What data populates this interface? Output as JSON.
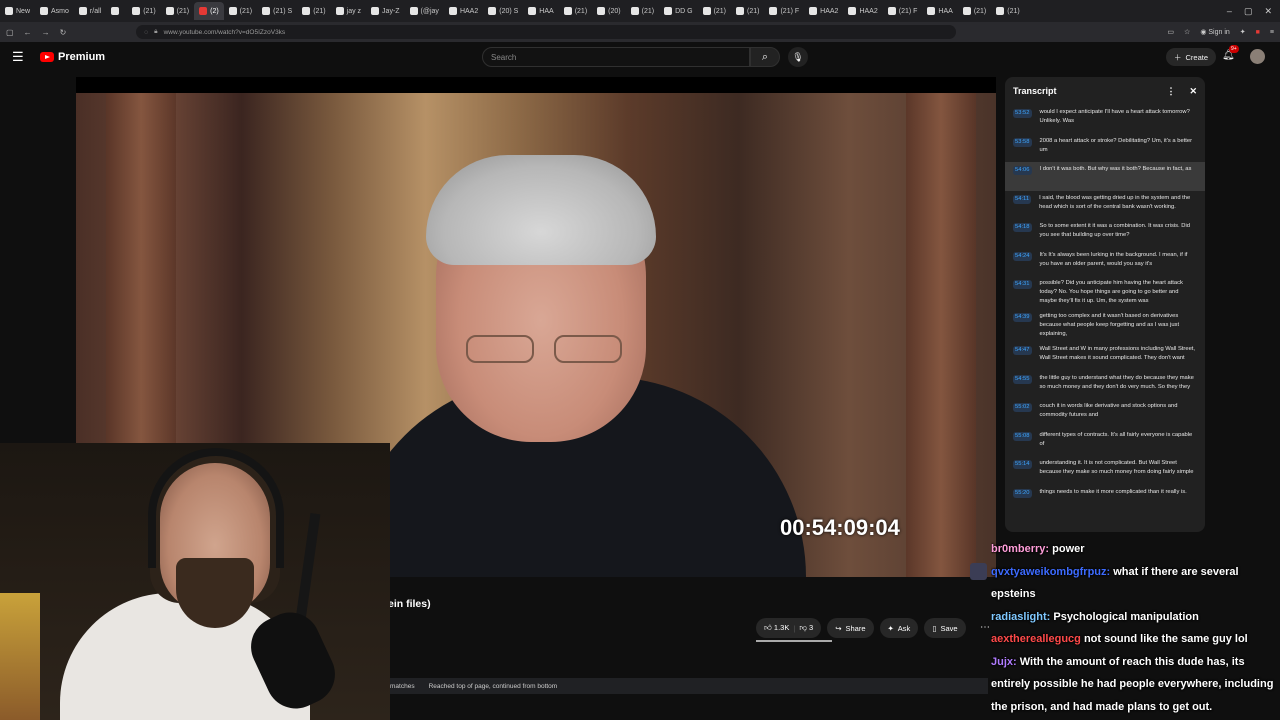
{
  "browser": {
    "tabs": [
      "New",
      "Asmo",
      "r/all",
      "",
      "(21)",
      "(21)",
      "(2)",
      "(21)",
      "(21) S",
      "(21)",
      "jay z",
      "Jay-Z",
      "(@jay",
      "HAA2",
      "(20) S",
      "HAA",
      "(21)",
      "(20)",
      "(21)",
      "DD G",
      "(21)",
      "(21)",
      "(21) F",
      "HAA2",
      "HAA2",
      "(21) F",
      "HAA",
      "(21)",
      "(21)"
    ],
    "url": "www.youtube.com/watch?v=dO5IZzoV3ks",
    "sign_in": "Sign in"
  },
  "youtube": {
    "brand": "Premium",
    "search_placeholder": "Search",
    "create_label": "Create",
    "notif_badge": "9+"
  },
  "video": {
    "timecode": "00:54:09:04",
    "title_fragment": "ein files)",
    "likes": "1.3K",
    "dislikes": "3",
    "share": "Share",
    "ask": "Ask",
    "save": "Save"
  },
  "findbar": {
    "matches": "matches",
    "status": "Reached top of page, continued from bottom"
  },
  "transcript": {
    "title": "Transcript",
    "rows": [
      {
        "time": "53:52",
        "text": "would I expect anticipate I'll have a heart attack tomorrow? Unlikely. Was"
      },
      {
        "time": "53:58",
        "text": "2008 a heart attack or stroke? Debilitating? Um, it's a better um"
      },
      {
        "time": "54:06",
        "text": "I don't it was both. But why was it both? Because in fact, as"
      },
      {
        "time": "54:11",
        "text": "I said, the blood was getting dried up in the system and the head which is sort of the central bank wasn't working."
      },
      {
        "time": "54:18",
        "text": "So to some extent it it was a combination. It was crisis. Did you see that building up over time?"
      },
      {
        "time": "54:24",
        "text": "It's It's always been lurking in the background. I mean, if if you have an older parent, would you say it's"
      },
      {
        "time": "54:31",
        "text": "possible? Did you anticipate him having the heart attack today? No. You hope things are going to go better and maybe they'll fix it up. Um, the system was"
      },
      {
        "time": "54:39",
        "text": "getting too complex and it wasn't based on derivatives because what people keep forgetting and as I was just explaining,"
      },
      {
        "time": "54:47",
        "text": "Wall Street and W in many professions including Wall Street, Wall Street makes it sound complicated. They don't want"
      },
      {
        "time": "54:55",
        "text": "the little guy to understand what they do because they make so much money and they don't do very much. So they they"
      },
      {
        "time": "55:02",
        "text": "couch it in words like derivative and stock options and commodity futures and"
      },
      {
        "time": "55:08",
        "text": "different types of contracts. It's all fairly everyone is capable of"
      },
      {
        "time": "55:14",
        "text": "understanding it. It is not complicated. But Wall Street because they make so much money from doing fairly simple"
      },
      {
        "time": "55:20",
        "text": "things needs to make it more complicated than it really is."
      }
    ]
  },
  "chat": [
    {
      "user": "br0mberry:",
      "color": "#ff9ed9",
      "text": "power"
    },
    {
      "user": "qvxtyaweikombgfrpuz:",
      "color": "#3d6bff",
      "text": "what if there are several epsteins"
    },
    {
      "user": "radiaslight:",
      "color": "#7fc8ff",
      "text": "Psychological manipulation"
    },
    {
      "user": "aexthereallegucg",
      "color": "#ff4a4a",
      "text": "not sound like the same guy lol"
    },
    {
      "user": "Jujx:",
      "color": "#b07cff",
      "text": "With the amount of reach this dude has, its entirely possible he had people everywhere, including the prison, and had made plans to get out."
    }
  ]
}
